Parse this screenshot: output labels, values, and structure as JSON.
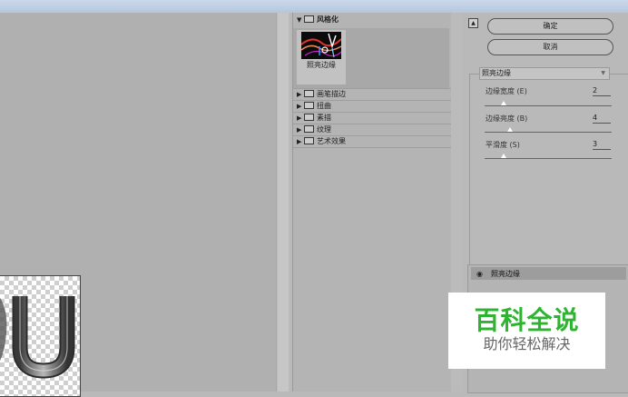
{
  "gallery": {
    "expanded_category": "风格化",
    "selected_thumbnail_label": "照亮边缘",
    "categories": [
      "画笔描边",
      "扭曲",
      "素描",
      "纹理",
      "艺术效果"
    ]
  },
  "buttons": {
    "ok": "确定",
    "cancel": "取消"
  },
  "filter_select": {
    "value": "照亮边缘"
  },
  "params": [
    {
      "label": "边缘宽度 (E)",
      "value": "2",
      "level": 0.15
    },
    {
      "label": "边缘亮度 (B)",
      "value": "4",
      "level": 0.2
    },
    {
      "label": "平滑度 (S)",
      "value": "3",
      "level": 0.15
    }
  ],
  "layer": {
    "label": "照亮边缘"
  },
  "watermark": {
    "title": "百科全说",
    "subtitle": "助你轻松解决"
  },
  "colors": {
    "watermark_green": "#2fb431",
    "panel_bg": "#b9b9b9"
  }
}
